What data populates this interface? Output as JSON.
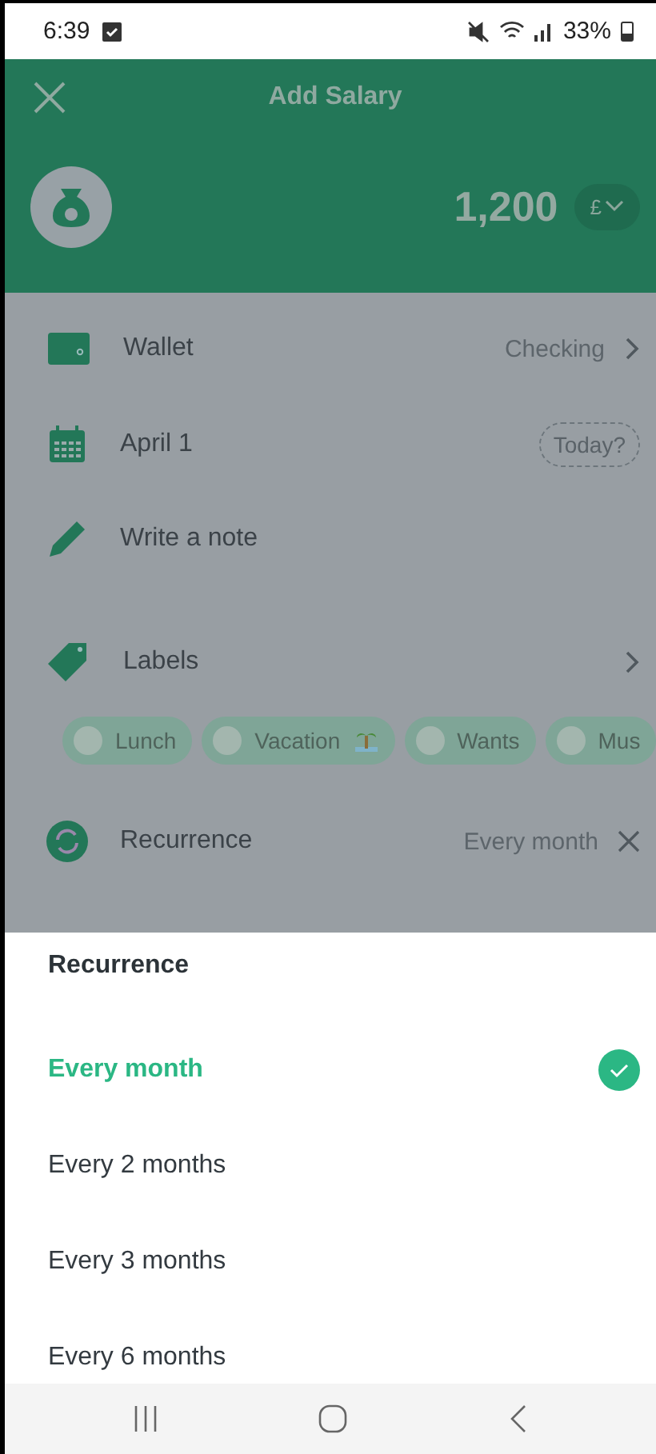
{
  "status_bar": {
    "time": "6:39",
    "battery": "33%"
  },
  "header": {
    "title": "Add Salary",
    "amount": "1,200",
    "currency": "£"
  },
  "rows": [
    {
      "kind": "wallet",
      "label": "Wallet",
      "value": "Checking"
    },
    {
      "kind": "date",
      "label": "April 1",
      "value": "Today?"
    },
    {
      "kind": "note",
      "label": "Write a note"
    },
    {
      "kind": "labels",
      "label": "Labels"
    }
  ],
  "labels": [
    {
      "name": "Lunch",
      "icon": false
    },
    {
      "name": "Vacation",
      "icon": true
    },
    {
      "name": "Wants",
      "icon": false
    },
    {
      "name": "Mus",
      "icon": false
    }
  ],
  "recurrence": {
    "label": "Recurrence",
    "value": "Every month"
  },
  "sheet": {
    "title": "Recurrence",
    "options": [
      {
        "label": "Every month",
        "selected": true
      },
      {
        "label": "Every 2 months",
        "selected": false
      },
      {
        "label": "Every 3 months",
        "selected": false
      },
      {
        "label": "Every 6 months",
        "selected": false
      }
    ]
  }
}
